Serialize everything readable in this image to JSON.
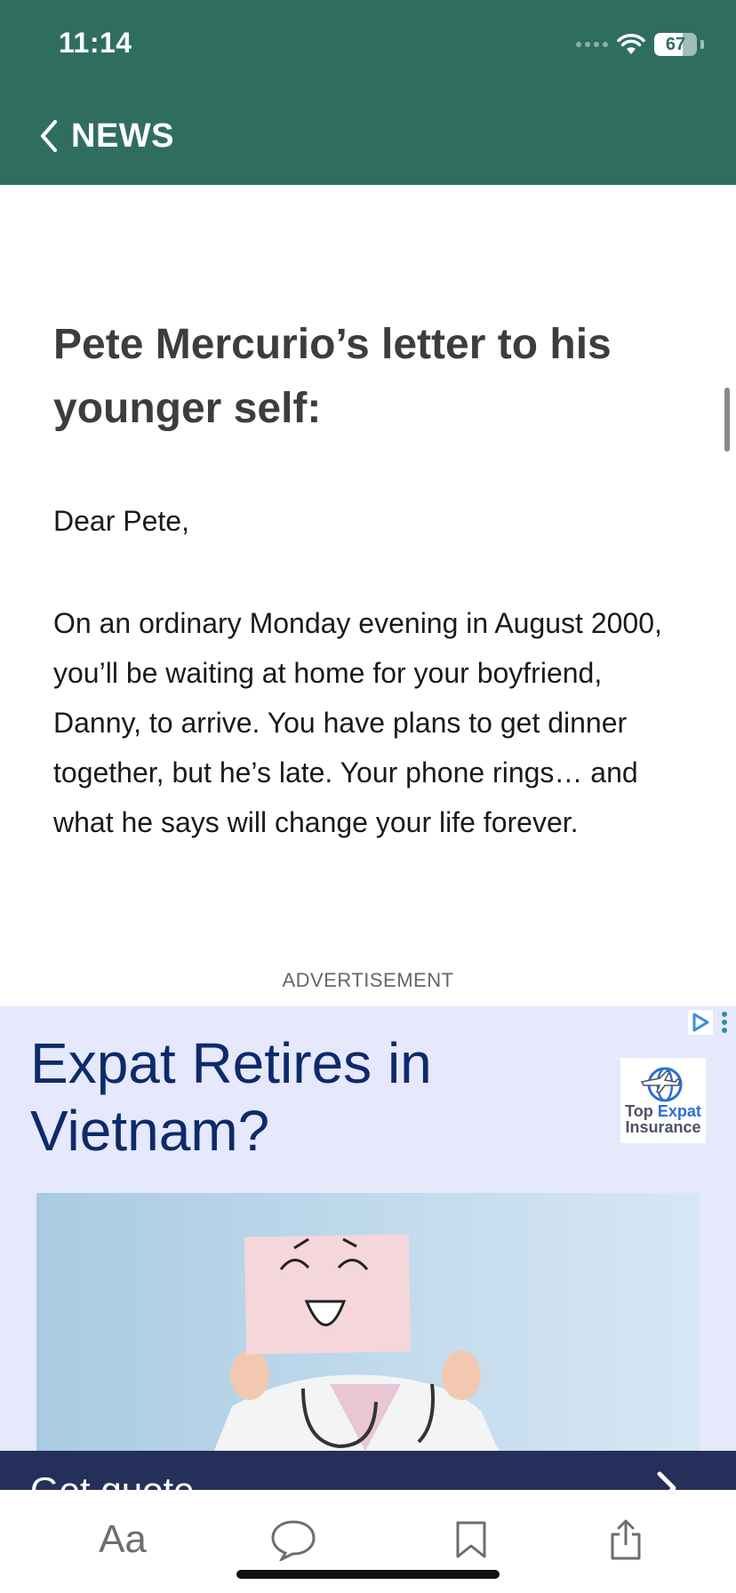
{
  "status_bar": {
    "time": "11:14",
    "battery_level": "67",
    "battery_fraction": 0.67
  },
  "nav": {
    "back_label": "NEWS"
  },
  "article": {
    "title": "Pete Mercurio’s letter to his younger self:",
    "salutation": "Dear Pete,",
    "paragraph": "On an ordinary Monday evening in August 2000, you’ll be waiting at home for your boyfriend, Danny, to arrive. You have plans to get dinner together, but he’s late. Your phone rings… and what he says will change your life forever."
  },
  "ad": {
    "label": "ADVERTISEMENT",
    "headline": "Expat Retires in Vietnam?",
    "logo_line1_a": "Top",
    "logo_line1_b": "Expat",
    "logo_line2": "Insurance",
    "cta": "Get quote"
  },
  "toolbar": {
    "font_label": "Aa",
    "items": [
      "text-size",
      "comments",
      "bookmark",
      "share"
    ]
  },
  "colors": {
    "header": "#2f6e5f",
    "ad_bg": "#e6e8fb",
    "ad_headline": "#0d2a6b",
    "cta_bg": "#25305a"
  }
}
